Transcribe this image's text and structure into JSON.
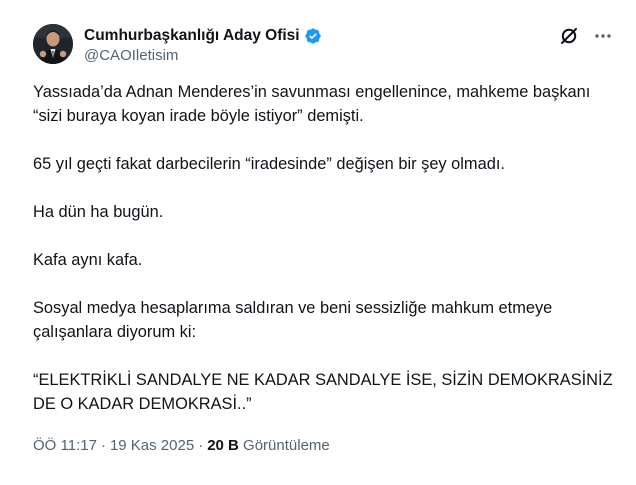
{
  "author": {
    "display_name": "Cumhurbaşkanlığı Aday Ofisi",
    "handle": "@CAOIletisim",
    "verified": true
  },
  "icons": {
    "avatar": "avatar-photo",
    "verified": "verified-badge-icon",
    "grok": "grok-icon",
    "more": "more-icon"
  },
  "colors": {
    "verified_blue": "#1d9bf0",
    "text_primary": "#0f1419",
    "text_secondary": "#536471"
  },
  "tweet": {
    "paragraphs": [
      "Yassıada’da Adnan Menderes’in savunması engellenince, mahkeme başkanı “sizi buraya koyan irade böyle istiyor” demişti.",
      "65 yıl geçti fakat darbecilerin “iradesinde” değişen bir şey olmadı.",
      "Ha dün ha bugün.",
      "Kafa aynı kafa.",
      "Sosyal medya hesaplarıma saldıran ve beni sessizliğe mahkum etmeye çalışanlara diyorum ki:",
      "“ELEKTRİKLİ SANDALYE NE KADAR SANDALYE İSE, SİZİN DEMOKRASİNİZ DE O KADAR DEMOKRASİ..”"
    ]
  },
  "meta": {
    "time": "ÖÖ 11:17",
    "separator": "·",
    "date": "19 Kas 2025",
    "views_count": "20 B",
    "views_label": "Görüntüleme"
  }
}
